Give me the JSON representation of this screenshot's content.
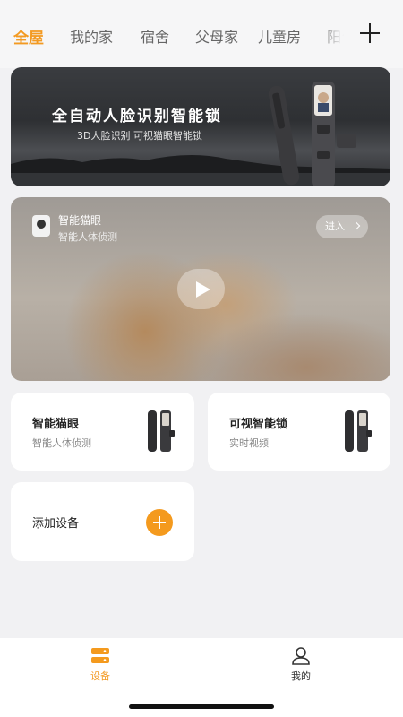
{
  "tabs": [
    "全屋",
    "我的家",
    "宿舍",
    "父母家",
    "儿童房",
    "阳台"
  ],
  "colors": {
    "accent": "#f39a22",
    "background": "#f1f1f3"
  },
  "banner": {
    "title": "全自动人脸识别智能锁",
    "subtitle": "3D人脸识别  可视猫眼智能锁"
  },
  "video": {
    "title": "智能猫眼",
    "subtitle": "智能人体侦测",
    "enter_label": "进入"
  },
  "devices": [
    {
      "title": "智能猫眼",
      "subtitle": "智能人体侦测"
    },
    {
      "title": "可视智能锁",
      "subtitle": "实时视频"
    }
  ],
  "add_device": {
    "label": "添加设备"
  },
  "nav": {
    "devices_label": "设备",
    "mine_label": "我的"
  },
  "icons": [
    "add-icon",
    "camera-icon",
    "play-icon",
    "chevron-right-icon",
    "plus-icon",
    "devices-icon",
    "user-icon"
  ]
}
